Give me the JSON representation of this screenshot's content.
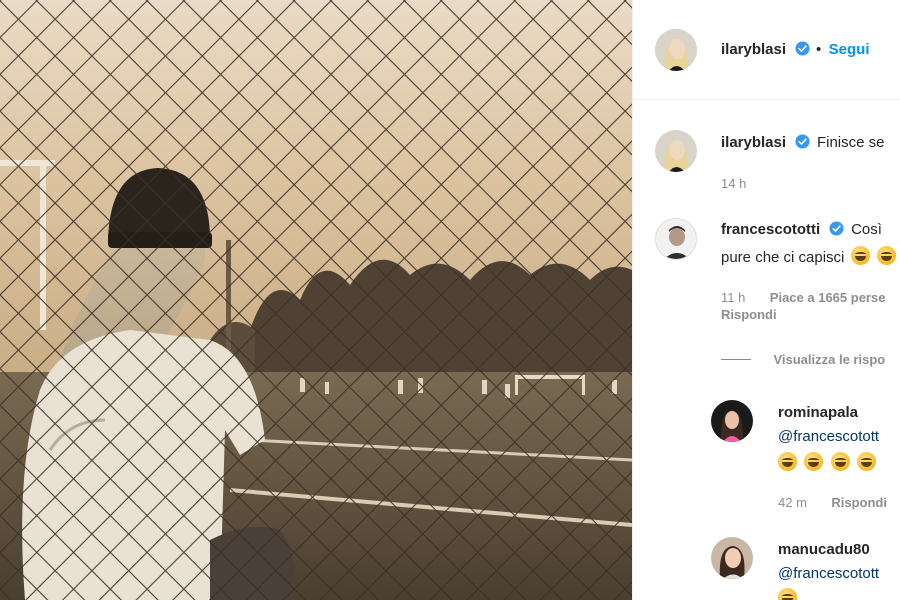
{
  "post": {
    "author": "ilaryblasi",
    "separator": "•",
    "follow_label": "Segui"
  },
  "caption": {
    "username": "ilaryblasi",
    "text": "Finisce se",
    "time": "14 h"
  },
  "comments": [
    {
      "username": "francescototti",
      "line1": "Così",
      "line2": "pure che ci capisci",
      "time": "11 h",
      "likes": "Piace a 1665 perse",
      "reply": "Rispondi",
      "view_replies": "Visualizza le rispo"
    }
  ],
  "replies": [
    {
      "username": "rominapala",
      "mention": "@francescotott",
      "emojis": 4,
      "time": "42 m",
      "reply": "Rispondi"
    },
    {
      "username": "manucadu80",
      "mention": "@francescotott"
    }
  ],
  "colors": {
    "link": "#0095f6",
    "verified": "#3897f0",
    "meta": "#8e8e8e"
  },
  "icons": [
    "verified-badge-icon",
    "grinning-emoji-icon"
  ]
}
